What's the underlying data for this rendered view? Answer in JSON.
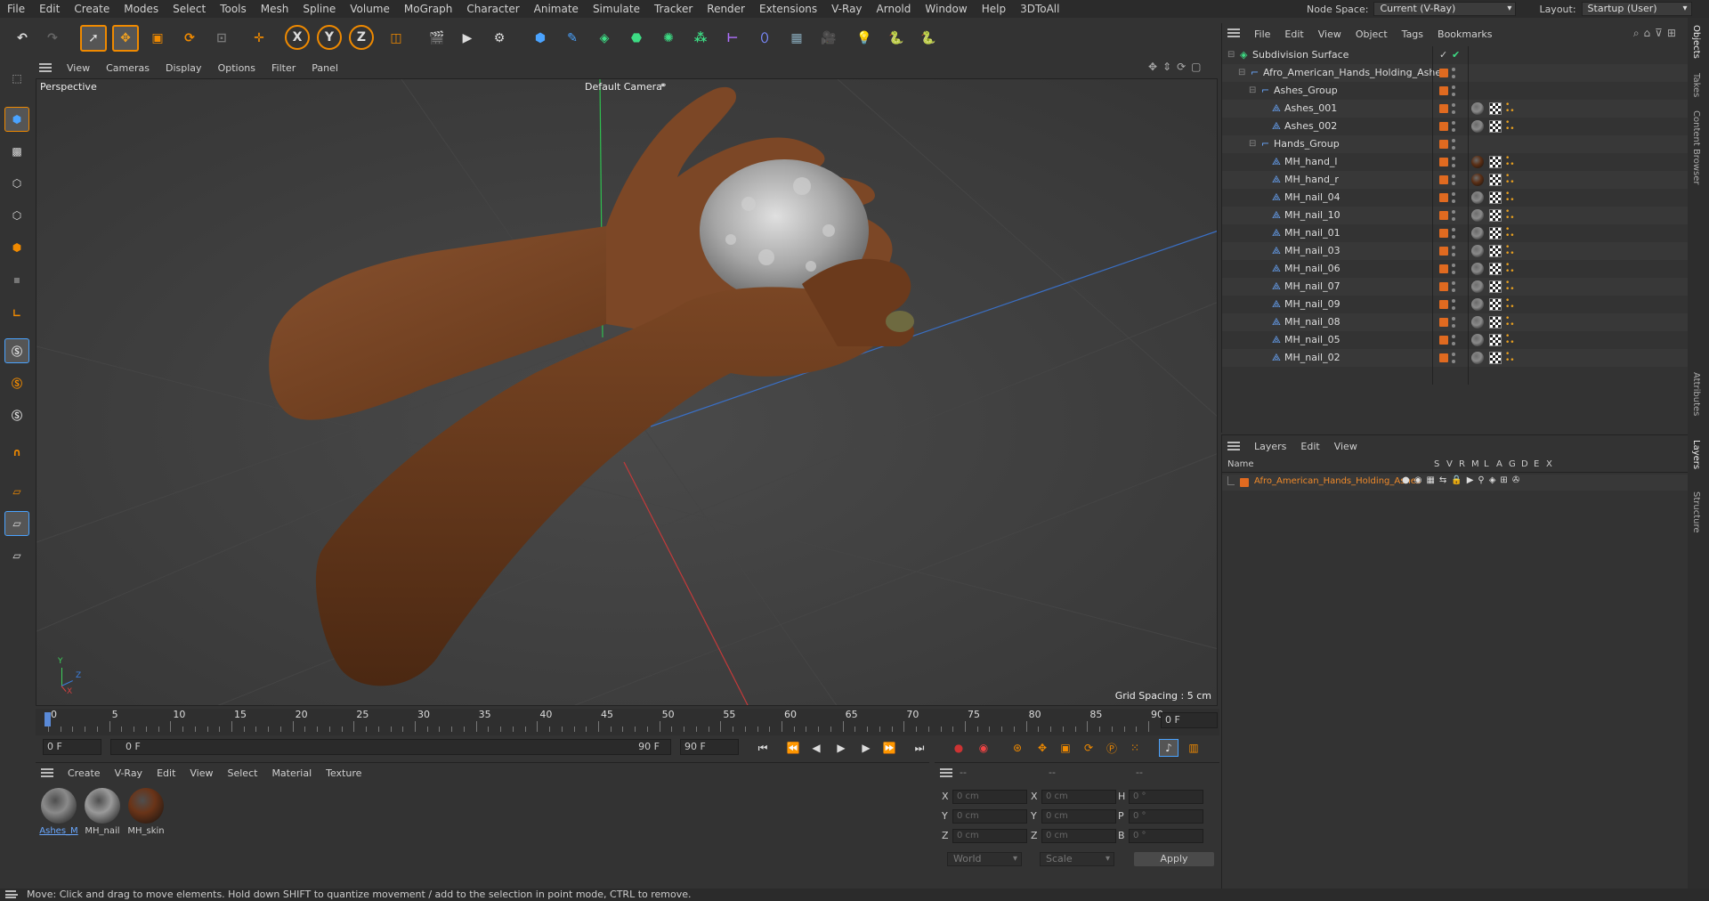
{
  "menubar": {
    "items": [
      "File",
      "Edit",
      "Create",
      "Modes",
      "Select",
      "Tools",
      "Mesh",
      "Spline",
      "Volume",
      "MoGraph",
      "Character",
      "Animate",
      "Simulate",
      "Tracker",
      "Render",
      "Extensions",
      "V-Ray",
      "Arnold",
      "Window",
      "Help",
      "3DToAll"
    ],
    "node_space_label": "Node Space:",
    "node_space_value": "Current (V-Ray)",
    "layout_label": "Layout:",
    "layout_value": "Startup (User)"
  },
  "toolbar": {
    "axis_x": "X",
    "axis_y": "Y",
    "axis_z": "Z"
  },
  "viewport": {
    "menu": [
      "View",
      "Cameras",
      "Display",
      "Options",
      "Filter",
      "Panel"
    ],
    "mode_label": "Perspective",
    "camera_label": "Default Camera",
    "grid_spacing": "Grid Spacing : 5 cm",
    "axis_y": "Y",
    "axis_z": "Z",
    "axis_x": "X"
  },
  "timeline": {
    "ticks": [
      "0",
      "5",
      "10",
      "15",
      "20",
      "25",
      "30",
      "35",
      "40",
      "45",
      "50",
      "55",
      "60",
      "65",
      "70",
      "75",
      "80",
      "85",
      "90"
    ],
    "current_frame_right": "0 F",
    "start_field": "0 F",
    "range_start": "0 F",
    "range_end": "90 F",
    "end_field": "90 F"
  },
  "materials": {
    "menu": [
      "Create",
      "V-Ray",
      "Edit",
      "View",
      "Select",
      "Material",
      "Texture"
    ],
    "items": [
      {
        "name": "Ashes_M",
        "color": "#8a8a8a"
      },
      {
        "name": "MH_nail",
        "color": "#9a9a9a"
      },
      {
        "name": "MH_skin",
        "color": "#6a3418"
      }
    ]
  },
  "coords": {
    "header": [
      "--",
      "--",
      "--"
    ],
    "rows": [
      {
        "a": "X",
        "av": "0 cm",
        "b": "X",
        "bv": "0 cm",
        "c": "H",
        "cv": "0 °"
      },
      {
        "a": "Y",
        "av": "0 cm",
        "b": "Y",
        "bv": "0 cm",
        "c": "P",
        "cv": "0 °"
      },
      {
        "a": "Z",
        "av": "0 cm",
        "b": "Z",
        "bv": "0 cm",
        "c": "B",
        "cv": "0 °"
      }
    ],
    "world": "World",
    "scale": "Scale",
    "apply": "Apply"
  },
  "status": "Move: Click and drag to move elements. Hold down SHIFT to quantize movement / add to the selection in point mode, CTRL to remove.",
  "objects": {
    "menu": [
      "File",
      "Edit",
      "View",
      "Object",
      "Tags",
      "Bookmarks"
    ],
    "rows": [
      {
        "name": "Subdivision Surface",
        "indent": 0
      },
      {
        "name": "Afro_American_Hands_Holding_Ashes",
        "indent": 1
      },
      {
        "name": "Ashes_Group",
        "indent": 2
      },
      {
        "name": "Ashes_001",
        "indent": 3
      },
      {
        "name": "Ashes_002",
        "indent": 3
      },
      {
        "name": "Hands_Group",
        "indent": 2
      },
      {
        "name": "MH_hand_l",
        "indent": 3
      },
      {
        "name": "MH_hand_r",
        "indent": 3
      },
      {
        "name": "MH_nail_04",
        "indent": 3
      },
      {
        "name": "MH_nail_10",
        "indent": 3
      },
      {
        "name": "MH_nail_01",
        "indent": 3
      },
      {
        "name": "MH_nail_03",
        "indent": 3
      },
      {
        "name": "MH_nail_06",
        "indent": 3
      },
      {
        "name": "MH_nail_07",
        "indent": 3
      },
      {
        "name": "MH_nail_09",
        "indent": 3
      },
      {
        "name": "MH_nail_08",
        "indent": 3
      },
      {
        "name": "MH_nail_05",
        "indent": 3
      },
      {
        "name": "MH_nail_02",
        "indent": 3
      }
    ]
  },
  "layers": {
    "menu": [
      "Layers",
      "Edit",
      "View"
    ],
    "col_name": "Name",
    "cols": [
      "S",
      "V",
      "R",
      "M",
      "L",
      "A",
      "G",
      "D",
      "E",
      "X"
    ],
    "row": "Afro_American_Hands_Holding_Ashes"
  },
  "right_tabs": [
    "Objects",
    "Takes",
    "Content Browser",
    "Attributes",
    "Layers",
    "Structure"
  ]
}
